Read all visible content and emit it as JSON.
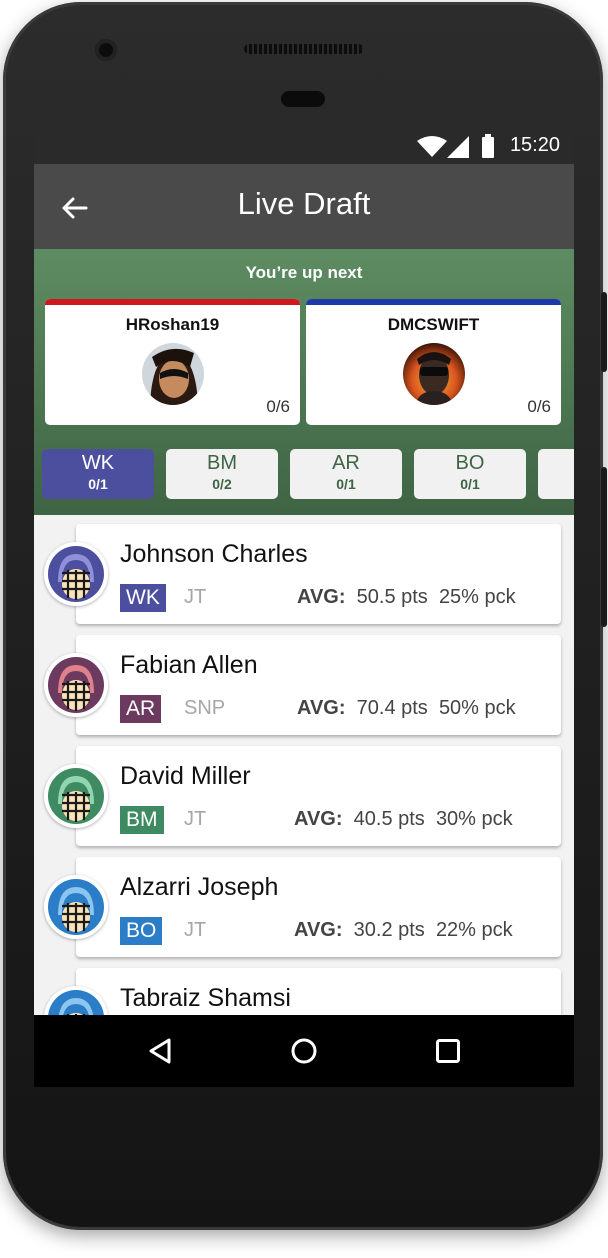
{
  "status": {
    "time": "15:20"
  },
  "appbar": {
    "title": "Live Draft"
  },
  "draft": {
    "up_next": "You’re up next",
    "players": [
      {
        "name": "HRoshan19",
        "count": "0/6",
        "bar_color": "#d0161e"
      },
      {
        "name": "DMCSWIFT",
        "count": "0/6",
        "bar_color": "#1d3aa8"
      }
    ]
  },
  "tabs": [
    {
      "label": "WK",
      "count": "0/1"
    },
    {
      "label": "BM",
      "count": "0/2"
    },
    {
      "label": "AR",
      "count": "0/1"
    },
    {
      "label": "BO",
      "count": "0/1"
    }
  ],
  "list": {
    "avg_label": "AVG:",
    "players": [
      {
        "name": "Johnson Charles",
        "role": "WK",
        "team": "JT",
        "avg": "50.5 pts",
        "pick": "25% pck",
        "color": "#4c4f9e"
      },
      {
        "name": "Fabian Allen",
        "role": "AR",
        "team": "SNP",
        "avg": "70.4 pts",
        "pick": "50% pck",
        "color": "#6b3a5e"
      },
      {
        "name": "David Miller",
        "role": "BM",
        "team": "JT",
        "avg": "40.5 pts",
        "pick": "30% pck",
        "color": "#3e8a62"
      },
      {
        "name": "Alzarri Joseph",
        "role": "BO",
        "team": "JT",
        "avg": "30.2 pts",
        "pick": "22% pck",
        "color": "#2a7dc6"
      },
      {
        "name": "Tabraiz Shamsi",
        "color": "#2a7dc6"
      }
    ]
  },
  "colors": {
    "accent": "#4c4f9e",
    "draft_bg": "#4e7a54",
    "appbar": "#4a4a4a"
  }
}
